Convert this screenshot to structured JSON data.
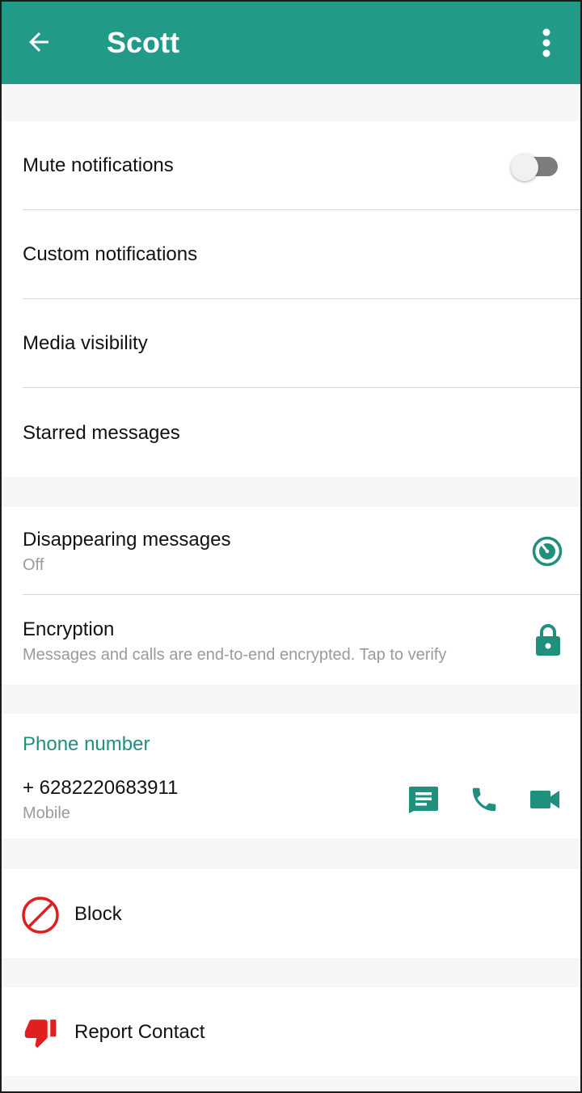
{
  "header": {
    "title": "Scott",
    "back_icon": "arrow-left-icon",
    "menu_icon": "more-vert-icon"
  },
  "settings": {
    "mute": {
      "label": "Mute notifications",
      "enabled": false
    },
    "custom": {
      "label": "Custom notifications"
    },
    "media": {
      "label": "Media visibility"
    },
    "starred": {
      "label": "Starred messages"
    }
  },
  "privacy": {
    "disappearing": {
      "label": "Disappearing messages",
      "value": "Off",
      "icon": "timer-icon"
    },
    "encryption": {
      "label": "Encryption",
      "description": "Messages and calls are end-to-end encrypted. Tap to verify",
      "icon": "lock-icon"
    }
  },
  "phone": {
    "section_title": "Phone number",
    "number": "+ 6282220683911",
    "type": "Mobile",
    "actions": {
      "message_icon": "message-icon",
      "call_icon": "phone-icon",
      "video_icon": "video-icon"
    }
  },
  "block": {
    "label": "Block",
    "icon": "block-icon"
  },
  "report": {
    "label": "Report Contact",
    "icon": "thumb-down-icon"
  },
  "colors": {
    "app_bar": "#219a88",
    "accent": "#1f8f7e",
    "danger": "#e02020"
  }
}
